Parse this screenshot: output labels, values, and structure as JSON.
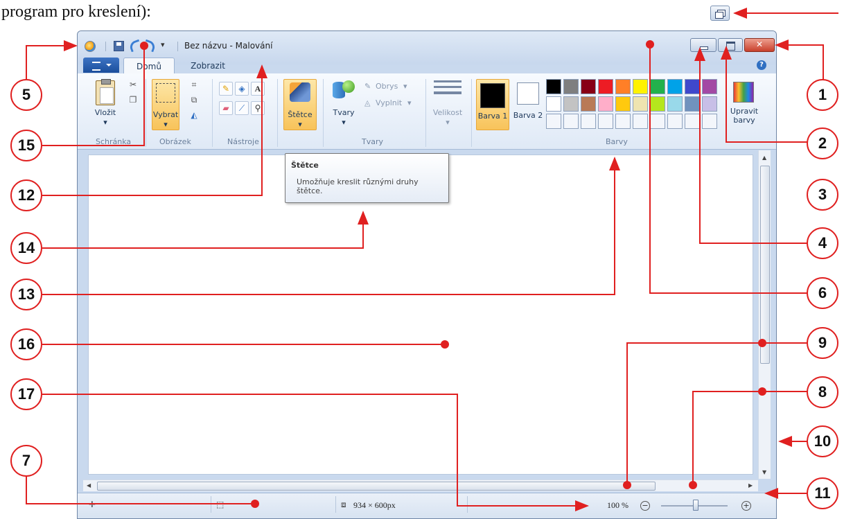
{
  "caption": "program pro kreslení):",
  "window": {
    "title": "Bez názvu - Malování",
    "close_glyph": "✕"
  },
  "tabs": {
    "home": "Domů",
    "view": "Zobrazit"
  },
  "ribbon": {
    "paste": "Vložit",
    "select": "Vybrat",
    "brushes": "Štětce",
    "shapes": "Tvary",
    "outline": "Obrys",
    "fill": "Vyplnit",
    "size": "Velikost",
    "color1": "Barva 1",
    "color2": "Barva 2",
    "edit_colors": "Upravit barvy",
    "groups": {
      "clipboard": "Schránka",
      "image": "Obrázek",
      "tools": "Nástroje",
      "shapes": "Tvary",
      "colors": "Barvy"
    },
    "palette_row1": [
      "#000000",
      "#7f7f7f",
      "#880015",
      "#ed1c24",
      "#ff7f27",
      "#fff200",
      "#22b14c",
      "#00a2e8",
      "#3f48cc",
      "#a349a4"
    ],
    "palette_row2": [
      "#ffffff",
      "#c3c3c3",
      "#b97a57",
      "#ffaec9",
      "#ffc90e",
      "#efe4b0",
      "#b5e61d",
      "#99d9ea",
      "#7092be",
      "#c8bfe7"
    ]
  },
  "tooltip": {
    "title": "Štětce",
    "description": "Umožňuje kreslit různými druhy štětce."
  },
  "status": {
    "dimensions": "934 × 600px",
    "zoom": "100 %"
  },
  "annotations": [
    "1",
    "2",
    "3",
    "4",
    "5",
    "6",
    "7",
    "8",
    "9",
    "10",
    "11",
    "12",
    "13",
    "14",
    "15",
    "16",
    "17"
  ]
}
